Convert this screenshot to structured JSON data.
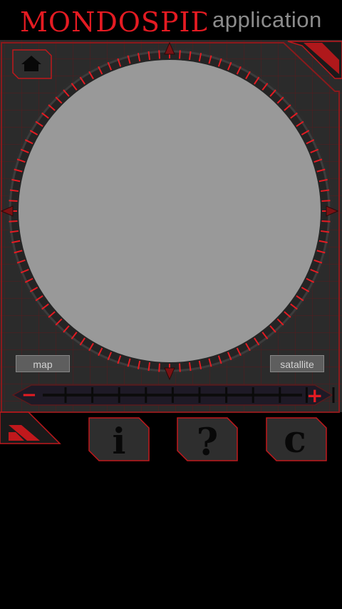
{
  "header": {
    "logo_text": "MONDOSPIDER",
    "subtitle": "application"
  },
  "map_controls": {
    "map_label": "map",
    "satellite_label": "satallite"
  },
  "zoom": {
    "minus_symbol": "−",
    "plus_symbol": "+"
  },
  "bottom_tabs": [
    {
      "glyph": "i",
      "icon": "info-icon"
    },
    {
      "glyph": "?",
      "icon": "help-icon"
    },
    {
      "glyph": "c",
      "icon": "credits-icon"
    }
  ],
  "colors": {
    "accent": "#e41b22",
    "panel_bg": "#2a2a2a",
    "map_fill": "#999999"
  }
}
